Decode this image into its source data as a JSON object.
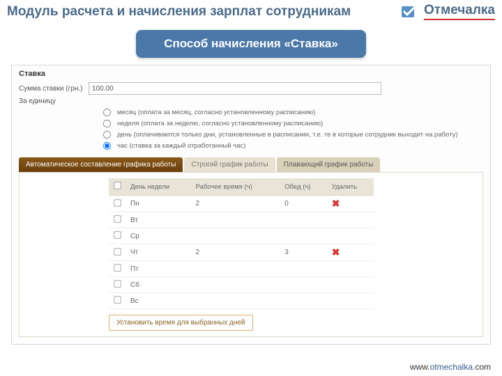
{
  "header": {
    "title": "Модуль расчета и начисления зарплат сотрудникам",
    "brand": "Отмечалка"
  },
  "subtitle": "Способ начисления  «Ставка»",
  "panel": {
    "title": "Ставка",
    "amount_label": "Сумма ставки (грн.)",
    "amount_value": "100.00",
    "period_label": "За единицу",
    "periods": [
      "месяц (оплата за месяц, согласно установленному расписанию)",
      "неделя (оплата за неделю, согласно установленному расписанию)",
      "день (оплачиваются только дни, установленные в расписании, т.е. те в которые сотрудник выходит на работу)",
      "час (ставка за каждый отработанный час)"
    ],
    "tab_auto": "Автоматическое составление графика работы",
    "tab_strict": "Строгий график работы",
    "tab_float": "Плавающий график работы"
  },
  "table": {
    "headers": [
      "",
      "День недели",
      "Рабочее время (ч)",
      "Обед (ч)",
      "Удалить"
    ],
    "rows": [
      {
        "day": "Пн",
        "work": "2",
        "lunch": "0",
        "del": true
      },
      {
        "day": "Вт",
        "work": "",
        "lunch": "",
        "del": false
      },
      {
        "day": "Ср",
        "work": "",
        "lunch": "",
        "del": false
      },
      {
        "day": "Чт",
        "work": "2",
        "lunch": "3",
        "del": true
      },
      {
        "day": "Пт",
        "work": "",
        "lunch": "",
        "del": false
      },
      {
        "day": "Сб",
        "work": "",
        "lunch": "",
        "del": false
      },
      {
        "day": "Вс",
        "work": "",
        "lunch": "",
        "del": false
      }
    ],
    "set_button": "Установить время для выбранных дней"
  },
  "footer": {
    "prefix": "www.",
    "domain": "otmechalka.",
    "suffix": "com"
  }
}
